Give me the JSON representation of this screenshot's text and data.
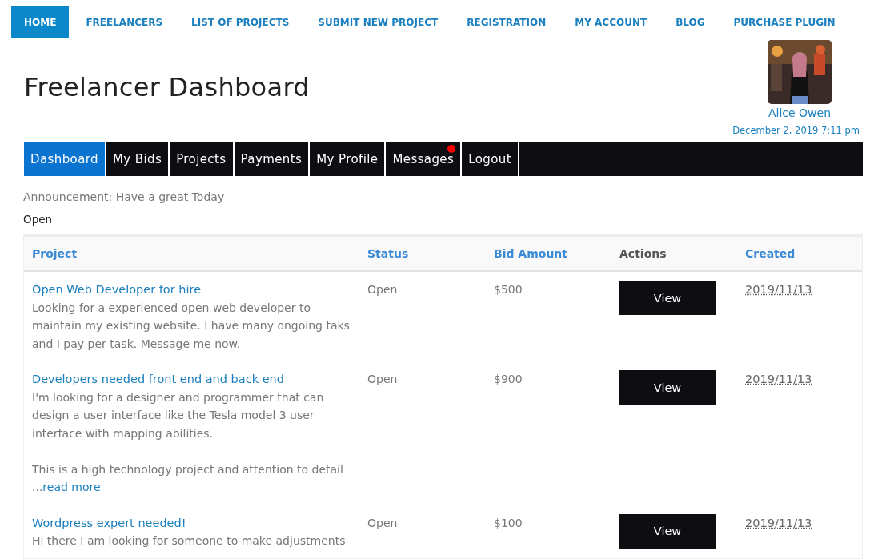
{
  "site_nav": [
    {
      "label": "HOME",
      "selected": true
    },
    {
      "label": "FREELANCERS",
      "selected": false
    },
    {
      "label": "LIST OF PROJECTS",
      "selected": false
    },
    {
      "label": "SUBMIT NEW PROJECT",
      "selected": false
    },
    {
      "label": "REGISTRATION",
      "selected": false
    },
    {
      "label": "MY ACCOUNT",
      "selected": false
    },
    {
      "label": "BLOG",
      "selected": false
    },
    {
      "label": "PURCHASE PLUGIN",
      "selected": false
    }
  ],
  "page_title": "Freelancer Dashboard",
  "user": {
    "name": "Alice Owen",
    "datetime": "December 2, 2019 7:11 pm"
  },
  "tabs": [
    {
      "label": "Dashboard",
      "selected": true,
      "notification": false
    },
    {
      "label": "My Bids",
      "selected": false,
      "notification": false
    },
    {
      "label": "Projects",
      "selected": false,
      "notification": false
    },
    {
      "label": "Payments",
      "selected": false,
      "notification": false
    },
    {
      "label": "My Profile",
      "selected": false,
      "notification": false
    },
    {
      "label": "Messages",
      "selected": false,
      "notification": true
    },
    {
      "label": "Logout",
      "selected": false,
      "notification": false
    }
  ],
  "announcement": "Announcement: Have a great Today",
  "filter_label": "Open",
  "table": {
    "columns": [
      {
        "label": "Project",
        "sortable": true
      },
      {
        "label": "Status",
        "sortable": true
      },
      {
        "label": "Bid Amount",
        "sortable": true
      },
      {
        "label": "Actions",
        "sortable": false
      },
      {
        "label": "Created",
        "sortable": true
      }
    ],
    "rows": [
      {
        "title": "Open Web Developer for hire",
        "description": [
          "Looking for a experienced open web developer to maintain my existing website. I have many ongoing taks and I pay per task. Message me now."
        ],
        "status": "Open",
        "bid": "$500",
        "action": "View",
        "created": "2019/11/13"
      },
      {
        "title": "Developers needed front end and back end",
        "description": [
          "I'm looking for a designer and programmer that can design a user interface like the Tesla model 3 user interface with mapping abilities.",
          "This is a high technology project and attention to detail"
        ],
        "ellipsis": "...",
        "read_more": "read more",
        "status": "Open",
        "bid": "$900",
        "action": "View",
        "created": "2019/11/13"
      },
      {
        "title": "Wordpress expert needed!",
        "description": [
          "Hi there I am looking for someone to make adjustments"
        ],
        "status": "Open",
        "bid": "$100",
        "action": "View",
        "created": "2019/11/13"
      }
    ]
  }
}
